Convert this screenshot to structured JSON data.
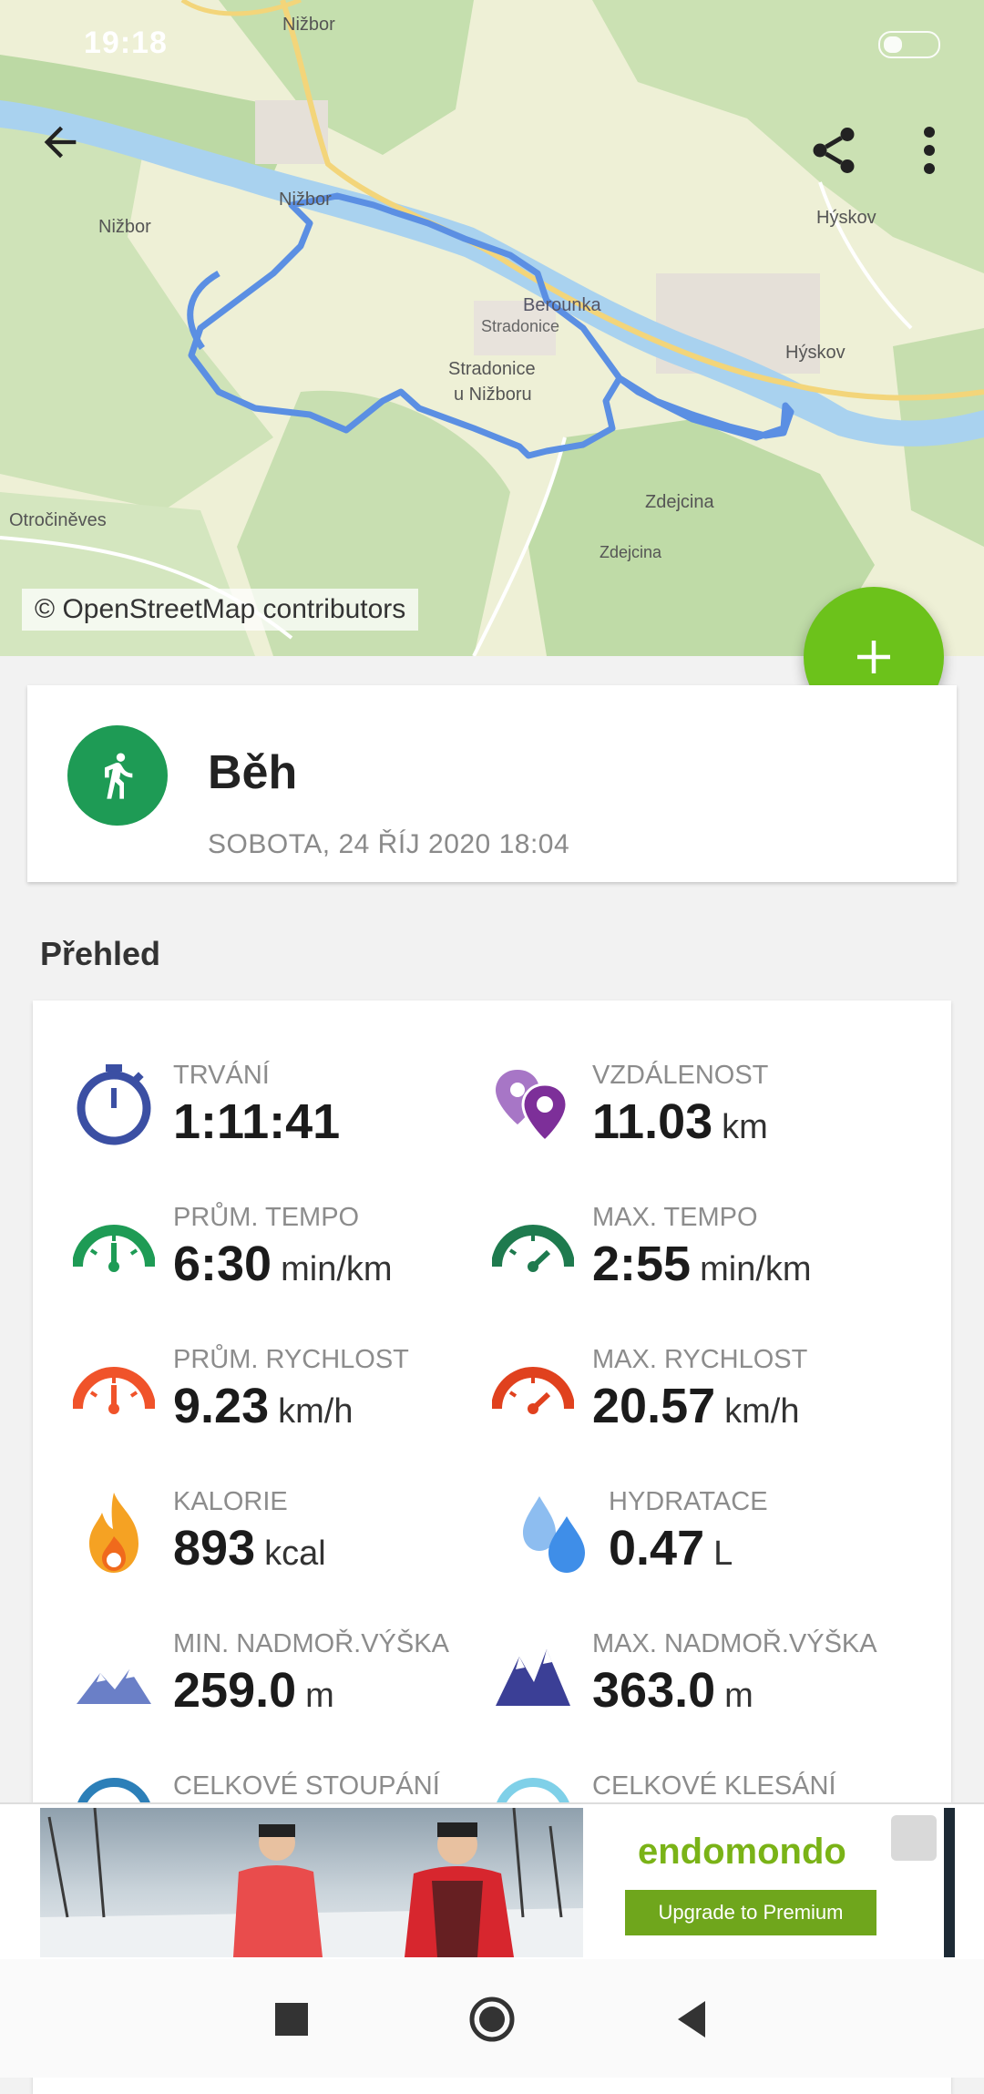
{
  "status_bar": {
    "time": "19:18"
  },
  "map": {
    "attribution": "© OpenStreetMap contributors",
    "places": {
      "p1": "Nižbor",
      "p2": "Nižbor",
      "p3": "Nižbor",
      "p4": "Hýskov",
      "p5": "Berounka",
      "p6": "Stradonice",
      "p7": "Stradonice",
      "p8": "u Nižboru",
      "p9": "Hýskov",
      "p10": "Zdejcina",
      "p11": "Zdejcina",
      "p12": "Otročiněves"
    }
  },
  "activity": {
    "sport": "Běh",
    "date": "SOBOTA, 24 ŘÍJ 2020 18:04",
    "sport_color": "#1e9b55"
  },
  "overview": {
    "title": "Přehled",
    "stats": [
      {
        "label": "TRVÁNÍ",
        "value": "1:11:41",
        "unit": ""
      },
      {
        "label": "VZDÁLENOST",
        "value": "11.03",
        "unit": "km"
      },
      {
        "label": "PRŮM. TEMPO",
        "value": "6:30",
        "unit": "min/km"
      },
      {
        "label": "MAX. TEMPO",
        "value": "2:55",
        "unit": "min/km"
      },
      {
        "label": "PRŮM. RYCHLOST",
        "value": "9.23",
        "unit": "km/h"
      },
      {
        "label": "MAX. RYCHLOST",
        "value": "20.57",
        "unit": "km/h"
      },
      {
        "label": "KALORIE",
        "value": "893",
        "unit": "kcal"
      },
      {
        "label": "HYDRATACE",
        "value": "0.47",
        "unit": "L"
      },
      {
        "label": "MIN. NADMOŘ.VÝŠKA",
        "value": "259.0",
        "unit": "m"
      },
      {
        "label": "MAX. NADMOŘ.VÝŠKA",
        "value": "363.0",
        "unit": "m"
      },
      {
        "label": "CELKOVÉ STOUPÁNÍ",
        "value": "",
        "unit": ""
      },
      {
        "label": "CELKOVÉ KLESÁNÍ",
        "value": "",
        "unit": ""
      }
    ]
  },
  "ad": {
    "brand": "endomondo",
    "cta": "Upgrade to Premium"
  },
  "colors": {
    "fab": "#6cc21b",
    "route": "#5b8fe3",
    "accent_green": "#1e9b55"
  }
}
